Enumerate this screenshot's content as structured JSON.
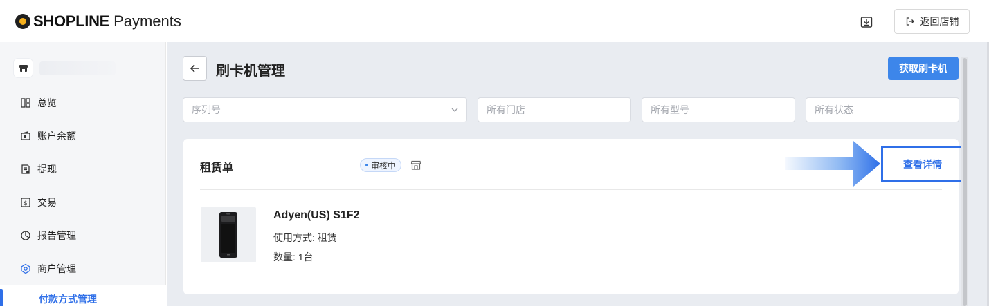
{
  "header": {
    "brand": "SHOPLINE",
    "product": "Payments",
    "download_icon": "download-icon",
    "back_store_label": "返回店铺",
    "back_store_icon": "exit-icon"
  },
  "sidebar": {
    "store_icon": "store-icon",
    "items": [
      {
        "label": "总览",
        "icon": "dashboard-icon"
      },
      {
        "label": "账户余额",
        "icon": "wallet-icon"
      },
      {
        "label": "提现",
        "icon": "withdraw-icon"
      },
      {
        "label": "交易",
        "icon": "transaction-icon"
      },
      {
        "label": "报告管理",
        "icon": "pie-chart-icon"
      },
      {
        "label": "商户管理",
        "icon": "merchant-icon"
      }
    ],
    "active_sub": "付款方式管理"
  },
  "main": {
    "title": "刷卡机管理",
    "primary_button": "获取刷卡机",
    "filters": {
      "serial": "序列号",
      "store": "所有门店",
      "model": "所有型号",
      "status": "所有状态"
    },
    "card": {
      "title": "租赁单",
      "status": "审核中",
      "detail_link": "查看详情",
      "device": {
        "name": "Adyen(US) S1F2",
        "usage": "使用方式: 租赁",
        "quantity": "数量: 1台"
      }
    }
  },
  "colors": {
    "accent": "#2f6fe8",
    "primary_button": "#3d86ea",
    "main_bg": "#e9ecf1",
    "sidebar_bg": "#f5f6f8"
  }
}
